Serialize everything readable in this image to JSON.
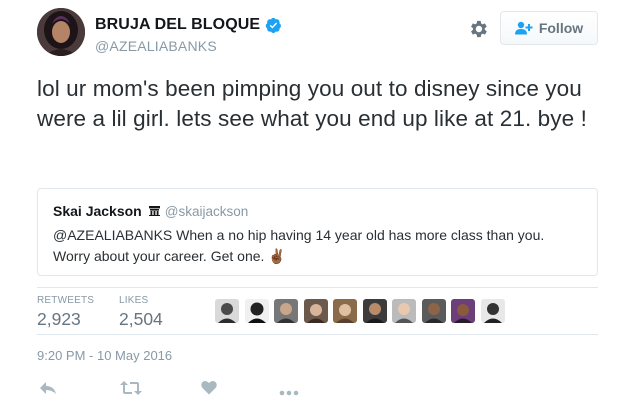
{
  "user": {
    "full_name": "BRUJA DEL BLOQUE",
    "screen_name": "@AZEALIABANKS",
    "follow_label": "Follow"
  },
  "tweet": {
    "text": "lol ur mom's been pimping you out to disney since you were a lil girl. lets see what you end up like at 21.  bye !"
  },
  "quote": {
    "name": "Skai Jackson",
    "screen_name": "@skaijackson",
    "text": "@AZEALIABANKS When a no hip having 14 year old has more class than you. Worry about your career. Get one. ✌🏾"
  },
  "stats": {
    "retweets_label": "RETWEETS",
    "retweets_count": "2,923",
    "likes_label": "LIKES",
    "likes_count": "2,504"
  },
  "timestamp": "9:20 PM - 10 May 2016",
  "colors": {
    "accent": "#1da1f2",
    "muted": "#8899a6",
    "icon": "#aab8c2",
    "border": "#e1e8ed"
  },
  "icons": {
    "verified": "verified-badge-icon",
    "gear": "gear-icon",
    "follow": "add-user-icon",
    "reply": "reply-icon",
    "retweet": "retweet-icon",
    "like": "heart-icon",
    "more": "more-icon"
  }
}
